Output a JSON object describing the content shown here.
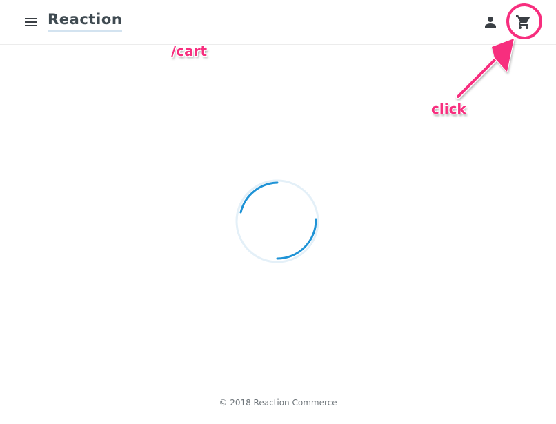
{
  "header": {
    "brand": "Reaction"
  },
  "icons": {
    "menu": "menu-icon",
    "account": "account-icon",
    "cart": "cart-icon"
  },
  "annotations": {
    "route_label": "/cart",
    "action_label": "click",
    "accent_color": "#f72e7e"
  },
  "loading": {
    "spinner_color": "#1f93d6",
    "track_color": "#e4f0f8"
  },
  "footer": {
    "copyright": "© 2018 Reaction Commerce"
  }
}
